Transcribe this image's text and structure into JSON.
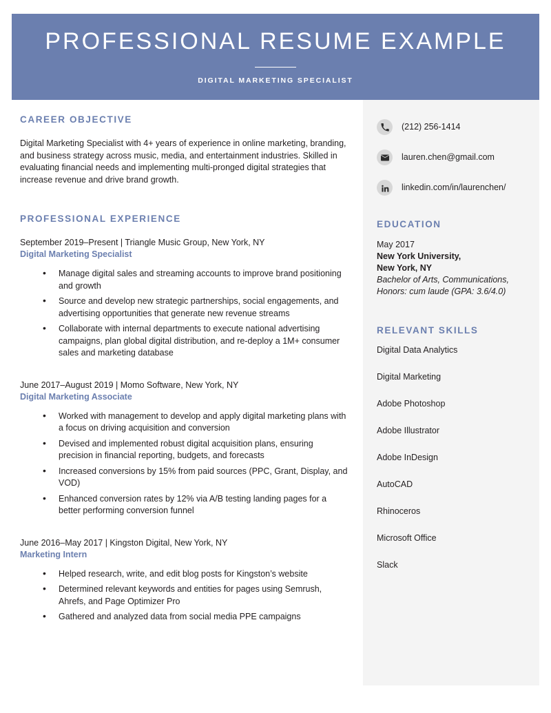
{
  "theme": {
    "banner_color": "#6b7faf",
    "heading_color": "#6b7faf",
    "sidebar_bg": "#f4f4f4",
    "body_text_color": "#231f20",
    "icon_circle_color": "#d7d7d7"
  },
  "header": {
    "title": "PROFESSIONAL RESUME EXAMPLE",
    "subtitle": "DIGITAL MARKETING SPECIALIST"
  },
  "main": {
    "objective": {
      "heading": "CAREER OBJECTIVE",
      "text": "Digital Marketing Specialist with 4+ years of experience in online marketing, branding, and business strategy across music, media, and entertainment industries. Skilled in evaluating financial needs and implementing multi-pronged digital strategies that increase revenue and drive brand growth."
    },
    "experience": {
      "heading": "PROFESSIONAL EXPERIENCE",
      "jobs": [
        {
          "meta": "September 2019–Present | Triangle Music Group, New York, NY",
          "title": "Digital Marketing Specialist",
          "bullets": [
            "Manage digital sales and streaming accounts to improve brand positioning and growth",
            "Source and develop new strategic partnerships, social engagements, and advertising opportunities that generate new revenue streams",
            "Collaborate with internal departments to execute national advertising campaigns, plan global digital distribution, and re-deploy a 1M+ consumer sales and marketing database"
          ]
        },
        {
          "meta": "June 2017–August 2019 | Momo Software, New York, NY",
          "title": "Digital Marketing Associate",
          "bullets": [
            "Worked with management to develop and apply digital marketing plans with a focus on driving acquisition and conversion",
            "Devised and implemented robust digital acquisition plans, ensuring precision in financial reporting, budgets, and forecasts",
            "Increased conversions by 15% from paid sources (PPC, Grant, Display, and VOD)",
            "Enhanced conversion rates by 12% via A/B testing landing pages for a better performing conversion funnel"
          ]
        },
        {
          "meta": "June 2016–May 2017 | Kingston Digital, New York, NY",
          "title": "Marketing Intern",
          "bullets": [
            "Helped research, write, and edit blog posts for Kingston’s website",
            "Determined relevant keywords and entities for pages using Semrush, Ahrefs, and Page Optimizer Pro",
            "Gathered and analyzed data from social media PPE campaigns"
          ]
        }
      ]
    }
  },
  "sidebar": {
    "contacts": [
      {
        "icon": "phone-icon",
        "text": "(212) 256-1414"
      },
      {
        "icon": "email-icon",
        "text": "lauren.chen@gmail.com"
      },
      {
        "icon": "linkedin-icon",
        "text": "linkedin.com/in/laurenchen/"
      }
    ],
    "education": {
      "heading": "EDUCATION",
      "date": "May 2017",
      "school": "New York University,",
      "location": "New York, NY",
      "degree": "Bachelor of Arts, Communications,",
      "honors": "Honors: cum laude (GPA: 3.6/4.0)"
    },
    "skills": {
      "heading": "RELEVANT SKILLS",
      "items": [
        "Digital Data Analytics",
        "Digital Marketing",
        "Adobe Photoshop",
        "Adobe Illustrator",
        "Adobe InDesign",
        "AutoCAD",
        "Rhinoceros",
        "Microsoft Office",
        "Slack"
      ]
    }
  }
}
